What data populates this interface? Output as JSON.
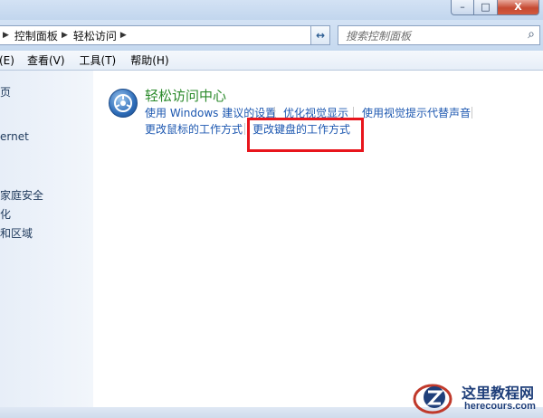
{
  "window": {
    "minimize_symbol": "–",
    "maximize_symbol": "□",
    "close_symbol": "X"
  },
  "address_bar": {
    "breadcrumbs": [
      "控制面板",
      "轻松访问"
    ],
    "search_placeholder": "搜索控制面板",
    "refresh_symbol": "↔"
  },
  "menu": {
    "items": [
      "(E)",
      "查看(V)",
      "工具(T)",
      "帮助(H)"
    ]
  },
  "sidebar": {
    "items": [
      "页",
      "ernet",
      "家庭安全",
      "化",
      "和区域"
    ]
  },
  "main": {
    "category_title": "轻松访问中心",
    "tasks": [
      "使用 Windows 建议的设置",
      "优化视觉显示",
      "使用视觉提示代替声音",
      "更改鼠标的工作方式",
      "更改键盘的工作方式"
    ],
    "highlighted_task_index": 4,
    "highlight_color": "#e8151c",
    "link_color": "#1c57b0",
    "title_color": "#2b8a2b"
  },
  "watermark": {
    "name": "这里教程网",
    "url": "herecours.com"
  }
}
